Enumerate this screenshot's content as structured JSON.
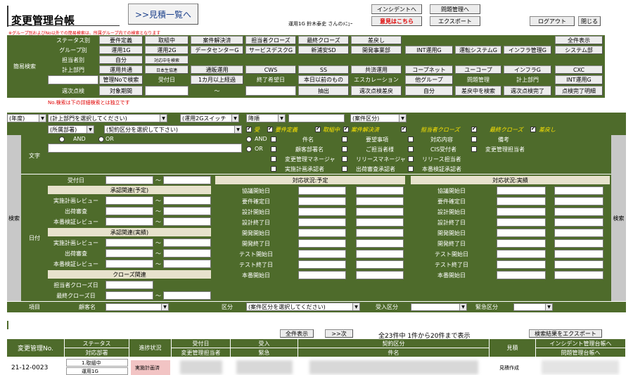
{
  "app": {
    "title": "変更管理台帳",
    "user_info": "運用1G 鈴木泰史 さんのﾒﾆｭｰ",
    "note_group": "※グループ別およびNo以外での簡易検索は、所属グループ内での検索となります",
    "note_no": "No.検索は下の詳細検索とは独立です"
  },
  "header_buttons": {
    "estimate_list": ">>見積一覧へ",
    "incident": "インシデントへ",
    "problem": "問題管理へ",
    "opinion": "意見はこちら",
    "export": "エクスポート",
    "logout": "ログアウト",
    "close": "閉じる"
  },
  "quick_search": {
    "section_label": "簡易検索",
    "status_label": "ステータス別",
    "group_label": "グループ別",
    "assignee_label": "担当者別",
    "dept_label": "計上部門",
    "review_label": "週次点検",
    "status_buttons": [
      "要件定義",
      "取組中",
      "案件解決済",
      "担当者クローズ",
      "最終クローズ",
      "差戻し"
    ],
    "show_all": "全件表示",
    "group_row1": [
      "運用1G",
      "運用2G",
      "データセンターG",
      "サービスデスクG",
      "新浦安SD",
      "開発事業部",
      "INT運用G",
      "運転システムG",
      "インフラ管理G",
      "システム部"
    ],
    "self": "自分",
    "self_included": "対応中を検索",
    "dept_row": [
      "運用共通",
      "日本生協連",
      "通販運用",
      "CWS",
      "SS",
      "共済運用",
      "コープネット",
      "ユーコープ",
      "インフラG",
      "CXC"
    ],
    "mgmt_no_search": "管理Noで検索",
    "received_date": "受付日",
    "over_month": "1カ月以上経過",
    "desired_end": "終了希望日",
    "before_today": "本日以前のもの",
    "escalation": "エスカレーション",
    "other_group": "他グループ",
    "problem_mgmt": "問題管理",
    "dept_btn": "計上部門",
    "int_ops": "INT運用G",
    "target_period": "対象期間",
    "tilde": "～",
    "extract": "抽出",
    "weekly_review_return": "週次点検差戻",
    "self2": "自分",
    "search_returned": "差戻中を検索",
    "weekly_done": "週次点検完了",
    "review_done_detail": "点検完了明細"
  },
  "filters": {
    "year": "(年度)",
    "dept": "(計上部門を選択してください)",
    "group": "(運用2Gスイッチ",
    "order": "降順",
    "case_type": "(案件区分)",
    "affiliation": "(所属部署)",
    "contract": "(契約区分を選択して下さい)"
  },
  "status_checks": [
    {
      "label": "受",
      "checked": true
    },
    {
      "label": "要件定義",
      "checked": true
    },
    {
      "label": "取組中",
      "checked": true
    },
    {
      "label": "案件解決済",
      "checked": true
    },
    {
      "label": "担当者クローズ",
      "checked": true
    },
    {
      "label": "最終クローズ",
      "checked": true
    },
    {
      "label": "差戻し",
      "checked": true
    }
  ],
  "text_search": {
    "label": "文字",
    "and": "AND",
    "or": "OR",
    "and2": "AND",
    "or2": "OR",
    "fields_row1": [
      "件名",
      "要望事項",
      "対応内容",
      "備考"
    ],
    "fields_row2": [
      "顧客部署名",
      "ご担当者様",
      "CIS受付者",
      "変更管理担当者"
    ],
    "fields_row3": [
      "変更管理マネージャ",
      "リリースマネージャ",
      "リリース担当者"
    ],
    "fields_row4": [
      "実施計画承認者",
      "出荷審査承認者",
      "本番検証承認者"
    ]
  },
  "detail": {
    "search_label": "検索",
    "date_label": "日付",
    "received": "受付日",
    "approval_planned": "承認関連(予定)",
    "approval_actual": "承認関連(実績)",
    "approval_rows": [
      "実施計画レビュー",
      "出荷審査",
      "本番検証レビュー"
    ],
    "close_related": "クローズ関連",
    "close_rows": [
      "担当者クローズ日",
      "最終クローズ日"
    ],
    "planned_header": "対応状況:予定",
    "actual_header": "対応状況:実績",
    "planned_rows": [
      "協議開始日",
      "要件確定日",
      "設計開始日",
      "設計終了日",
      "開発開始日",
      "開発終了日",
      "テスト開始日",
      "テスト終了日",
      "本番開始日"
    ],
    "actual_rows": [
      "協議開始日",
      "要件確定日",
      "設計開始日",
      "設計終了日",
      "開発開始日",
      "開発終了日",
      "テスト開始日",
      "テスト終了日",
      "本番開始日"
    ],
    "tilde": "～"
  },
  "item_row": {
    "label": "項目",
    "customer": "顧客名",
    "category": "区分",
    "case_select": "(案件区分を選択してください)",
    "receive_type": "受入区分",
    "urgency": "緊急区分"
  },
  "results": {
    "show_all": "全件表示",
    "next": ">>次",
    "summary": "全23件中 1件から20件まで表示",
    "export": "検索結果をエクスポート",
    "columns": {
      "mgmt_no": "変更管理No.",
      "status": "ステータス",
      "dept": "対応部署",
      "progress": "進捗状況",
      "received": "受付日",
      "assignee": "変更管理担当者",
      "receive": "受入",
      "urgent": "緊急",
      "contract": "契約区分",
      "subject": "件名",
      "estimate": "見積",
      "incident": "インシデント管理台帳へ",
      "problem": "問題管理台帳へ"
    },
    "rows": [
      {
        "mgmt_no": "21-12-0023",
        "status": "1.取組中",
        "dept": "運用1G",
        "progress": "実施計画済",
        "estimate": "見積作成"
      }
    ]
  },
  "colors": {
    "accent_green": "#4e6b2b",
    "tan": "#e7e2cc",
    "red_text": "#e00000"
  }
}
